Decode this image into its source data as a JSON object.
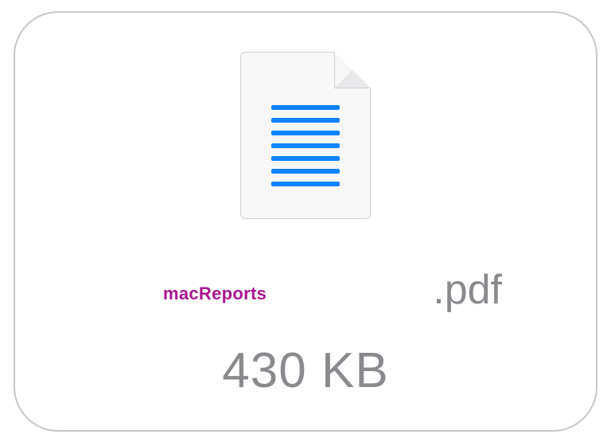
{
  "attachment": {
    "watermark": "macReports",
    "extension": ".pdf",
    "filesize": "430 KB"
  }
}
